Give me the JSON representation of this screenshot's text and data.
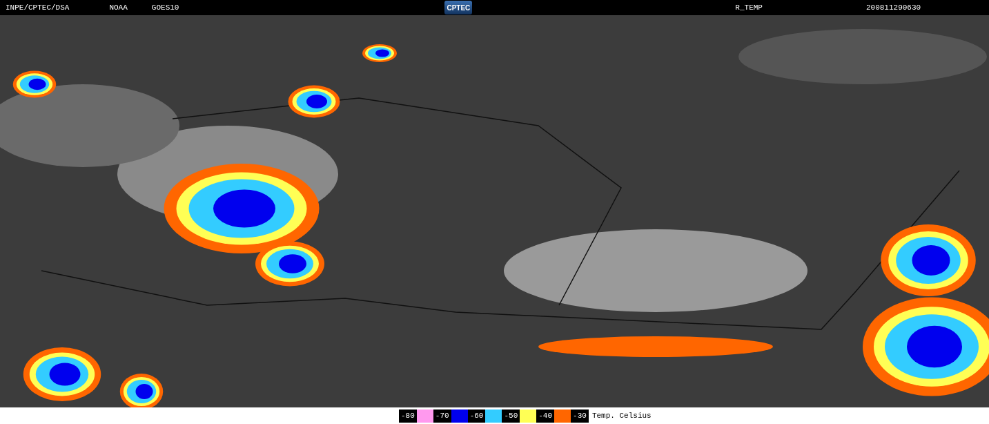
{
  "header": {
    "source": "INPE/CPTEC/DSA",
    "agency": "NOAA",
    "satellite": "GOES10",
    "logo": "CPTEC",
    "product": "R_TEMP",
    "timestamp": "200811290630"
  },
  "legend": {
    "steps": [
      {
        "label": "-80",
        "color": "#ff99ee"
      },
      {
        "label": "-70",
        "color": "#0000ee"
      },
      {
        "label": "-60",
        "color": "#33ccff"
      },
      {
        "label": "-50",
        "color": "#ffff55"
      },
      {
        "label": "-40",
        "color": "#ff6600"
      },
      {
        "label": "-30"
      }
    ],
    "unit": "Temp. Celsius"
  }
}
